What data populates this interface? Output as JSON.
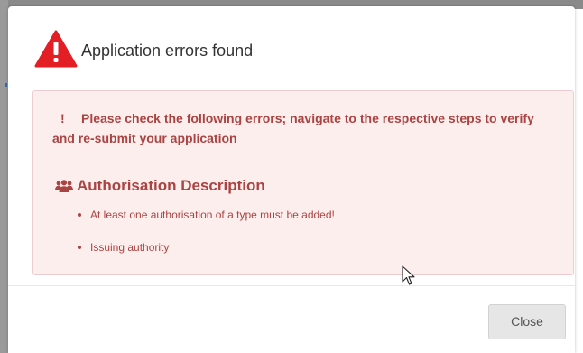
{
  "colors": {
    "error_text": "#a94442",
    "error_background": "#fdeeee",
    "error_border": "#ebccd1",
    "warning_icon": "#e31e24"
  },
  "dialog": {
    "title": "Application errors found",
    "header_icon": "warning-triangle-icon"
  },
  "error_panel": {
    "marker": "!",
    "message": "Please check the following errors; navigate to the respective steps to verify and re-submit your application",
    "section": {
      "icon": "users-icon",
      "heading": "Authorisation Description",
      "items": [
        "At least one authorisation of a type must be added!",
        "Issuing authority"
      ]
    }
  },
  "footer": {
    "close_label": "Close"
  }
}
